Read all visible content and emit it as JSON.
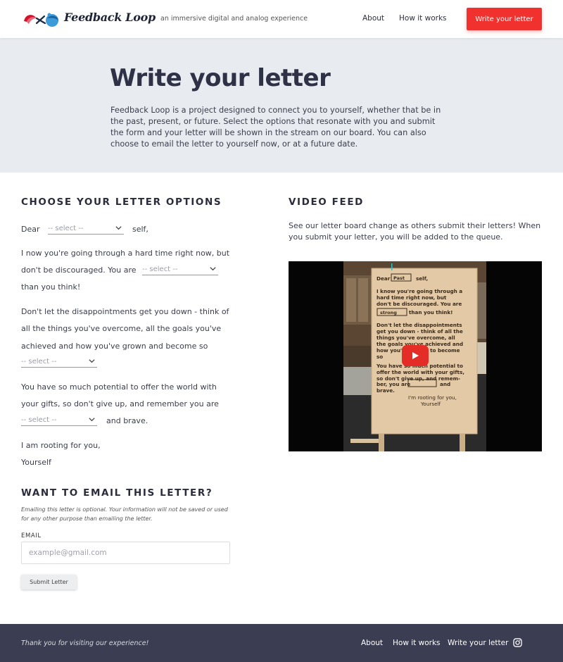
{
  "header": {
    "brand": "Feedback Loop",
    "tagline": "an immersive digital and analog experience",
    "nav": {
      "about": "About",
      "how": "How it works"
    },
    "cta": "Write your letter"
  },
  "hero": {
    "title": "Write your letter",
    "body": "Feedback Loop is a project designed to connect you to yourself, whether that be in the past, present, or future. Select the options that resonate with you and submit the form and your letter will be shown in the stream on our board. You can also choose to email the letter to yourself now, or at a future date."
  },
  "letter": {
    "title": "CHOOSE YOUR LETTER OPTIONS",
    "dear": "Dear",
    "self": "self,",
    "select_placeholder": "-- select --",
    "p1_a": "I now you're going through a hard time right now, but",
    "p1_b": "don't be discouraged. You are",
    "p1_c": "than you think!",
    "p2_a": "Don't let the disappointments get you down - think of",
    "p2_b": "all the things you've overcome, all the goals you've",
    "p2_c": "achieved and how you've grown and become so",
    "p3_a": "You have so much potential to offer the world with",
    "p3_b": "your gifts, so don't give up, and remember you are",
    "p3_c": "and brave.",
    "closing": "I am rooting for you,",
    "signature": "Yourself"
  },
  "email": {
    "title": "WANT TO EMAIL THIS LETTER?",
    "note": "Emailing this letter is optional. Your information will not be saved or used for any other purpose than emailing the letter.",
    "label": "EMAIL",
    "placeholder": "example@gmail.com",
    "submit": "Submit Letter"
  },
  "video": {
    "title": "VIDEO FEED",
    "description": "See our letter board change as others submit their letters! When you submit your letter, you will be added to the queue.",
    "board_lines": [
      "Dear",
      "Past",
      "self,",
      "I know you're going through a",
      "hard time right now, but",
      "don't be discouraged. You are",
      "strong",
      "than you think!",
      "Don't let the disappointments",
      "get you down - think of all the",
      "things you've overcome, all",
      "the goals you've achieved and",
      "how you've grown to become",
      "so",
      "You have so much potential to",
      "offer the world with your gifts,",
      "so don't give up, and remem-",
      "ber, you are",
      "and",
      "brave.",
      "I'm rooting for you,",
      "Yourself"
    ]
  },
  "footer": {
    "thanks": "Thank you for visiting our experience!",
    "links": {
      "about": "About",
      "how": "How it works",
      "write": "Write your letter"
    }
  },
  "colors": {
    "accent": "#f0312d",
    "hero_bg": "#e8ebef",
    "footer_bg": "#3b3e52",
    "heading": "#2f3146"
  }
}
